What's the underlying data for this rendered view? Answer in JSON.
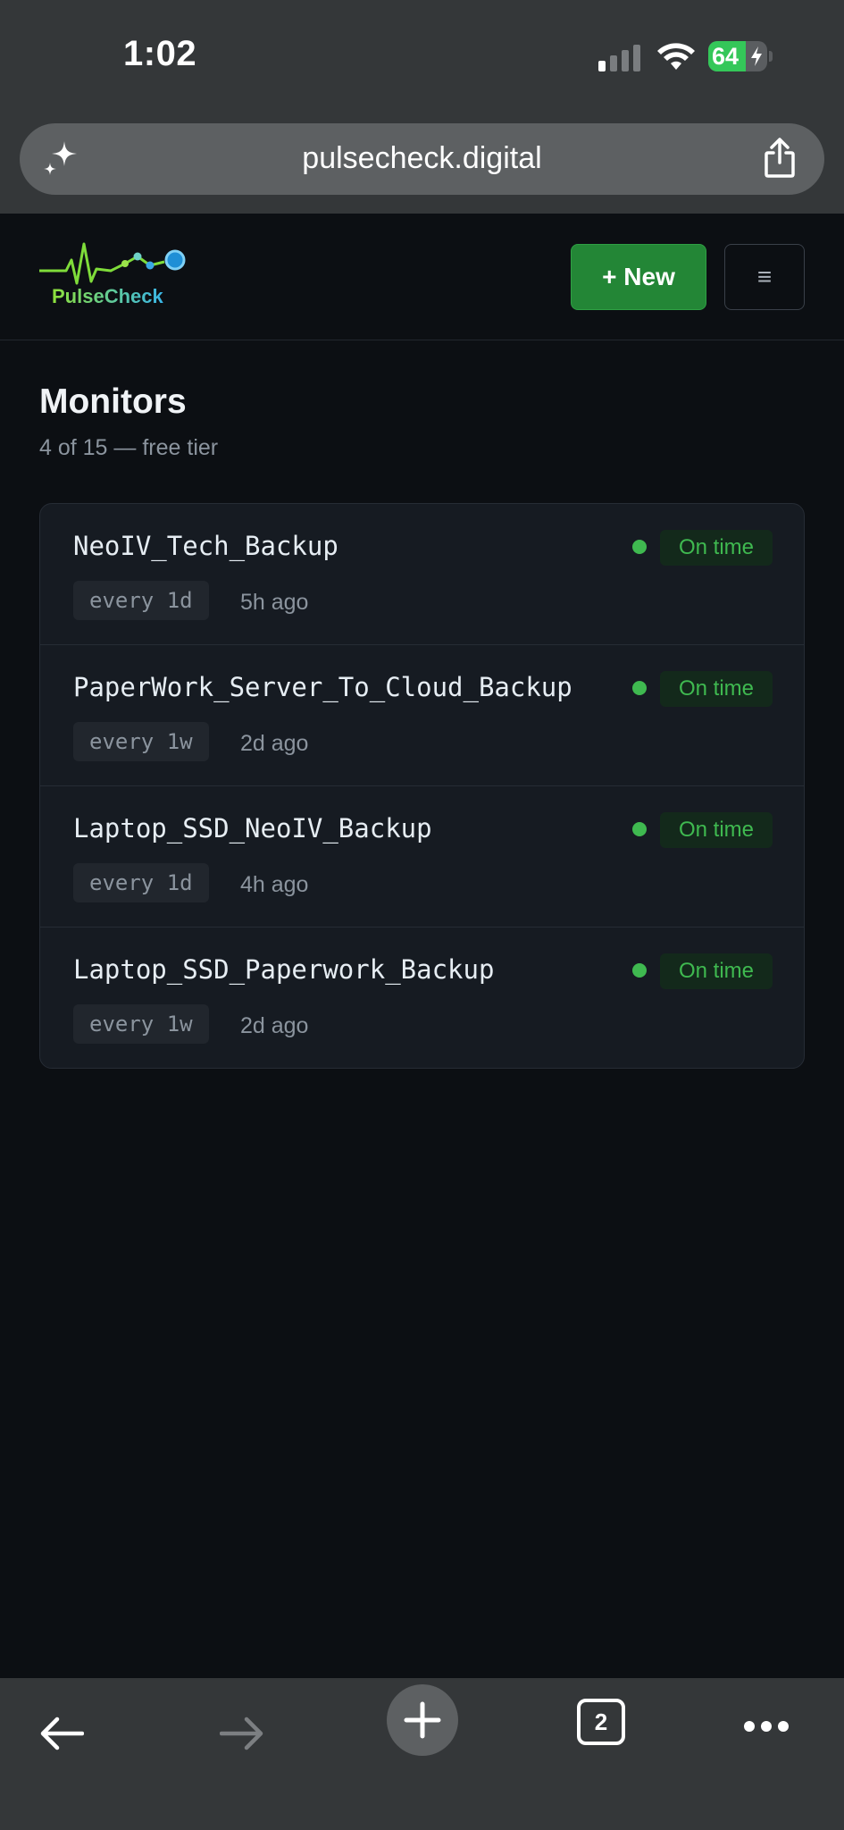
{
  "status_bar": {
    "time": "1:02",
    "battery_percent": "64",
    "battery_level": 0.64,
    "icons": [
      "signal-icon",
      "wifi-icon",
      "battery-icon",
      "charging-bolt-icon"
    ]
  },
  "browser": {
    "url": "pulsecheck.digital",
    "icons": [
      "sparkle-icon",
      "share-icon"
    ],
    "toolbar": {
      "tab_count": "2",
      "icons": [
        "back-arrow-icon",
        "forward-arrow-icon",
        "plus-icon",
        "tabs-icon",
        "more-icon"
      ]
    }
  },
  "header": {
    "logo_text": "PulseCheck",
    "new_button_label": "+ New",
    "menu_button_label": "≡"
  },
  "page": {
    "title": "Monitors",
    "subtitle": "4 of 15 — free tier"
  },
  "monitors": [
    {
      "name": "NeoIV_Tech_Backup",
      "interval": "every 1d",
      "last_ping": "5h ago",
      "status": "On time"
    },
    {
      "name": "PaperWork_Server_To_Cloud_Backup",
      "interval": "every 1w",
      "last_ping": "2d ago",
      "status": "On time"
    },
    {
      "name": "Laptop_SSD_NeoIV_Backup",
      "interval": "every 1d",
      "last_ping": "4h ago",
      "status": "On time"
    },
    {
      "name": "Laptop_SSD_Paperwork_Backup",
      "interval": "every 1w",
      "last_ping": "2d ago",
      "status": "On time"
    }
  ],
  "colors": {
    "accent_green": "#238636",
    "status_green": "#3fb950",
    "background": "#0c0f13",
    "card": "#161b22"
  }
}
